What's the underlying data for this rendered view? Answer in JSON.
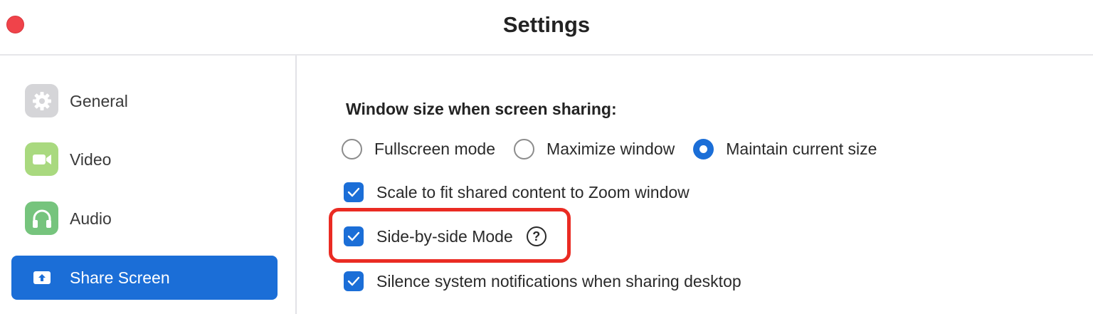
{
  "window": {
    "title": "Settings"
  },
  "sidebar": {
    "items": [
      {
        "label": "General",
        "icon": "gear-icon",
        "icon_bg": "#d5d5d8",
        "active": false
      },
      {
        "label": "Video",
        "icon": "video-camera-icon",
        "icon_bg": "#a9d97f",
        "active": false
      },
      {
        "label": "Audio",
        "icon": "headphones-icon",
        "icon_bg": "#76c47d",
        "active": false
      },
      {
        "label": "Share Screen",
        "icon": "share-screen-icon",
        "icon_bg": "#1b6ed7",
        "active": true
      }
    ]
  },
  "share_screen": {
    "window_size_heading": "Window size when screen sharing:",
    "window_size_options": [
      {
        "label": "Fullscreen mode",
        "selected": false
      },
      {
        "label": "Maximize window",
        "selected": false
      },
      {
        "label": "Maintain current size",
        "selected": true
      }
    ],
    "checkboxes": [
      {
        "label": "Scale to fit shared content to Zoom window",
        "checked": true
      },
      {
        "label": "Side-by-side Mode",
        "checked": true,
        "help": "?"
      },
      {
        "label": "Silence system notifications when sharing desktop",
        "checked": true
      }
    ]
  },
  "colors": {
    "accent": "#1b6ed7",
    "highlight": "#ea2b23",
    "close_button": "#f0434a"
  }
}
